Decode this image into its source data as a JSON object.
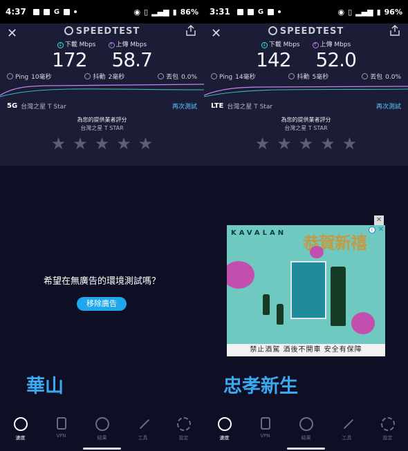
{
  "panels": [
    {
      "status": {
        "time": "4:37",
        "battery": "86%"
      },
      "brand": "SPEEDTEST",
      "download_label": "下載 Mbps",
      "upload_label": "上傳 Mbps",
      "download": "172",
      "upload": "58.7",
      "ping_label": "Ping",
      "ping": "10毫秒",
      "jitter_label": "抖動",
      "jitter": "2毫秒",
      "loss_label": "丟包",
      "loss": "0.0%",
      "network_type": "5G",
      "carrier": "台灣之星 T Star",
      "retest": "再次測試",
      "rate_title": "為您的提供業者評分",
      "rate_carrier": "台灣之星 T STAR",
      "location": "華山"
    },
    {
      "status": {
        "time": "3:31",
        "battery": "96%"
      },
      "brand": "SPEEDTEST",
      "download_label": "下載 Mbps",
      "upload_label": "上傳 Mbps",
      "download": "142",
      "upload": "52.0",
      "ping_label": "Ping",
      "ping": "14毫秒",
      "jitter_label": "抖動",
      "jitter": "5毫秒",
      "loss_label": "丟包",
      "loss": "0.0%",
      "network_type": "LTE",
      "carrier": "台灣之星 T Star",
      "retest": "再次測試",
      "rate_title": "為您的提供業者評分",
      "rate_carrier": "台灣之星 T STAR",
      "location": "忠孝新生"
    }
  ],
  "noads": {
    "question": "希望在無廣告的環境測試嗎？",
    "button": "移除廣告"
  },
  "ad": {
    "brand": "KAVALAN",
    "headline": "恭賀新禧",
    "footer": "禁止酒駕 酒後不開車 安全有保障"
  },
  "nav": [
    "速度",
    "VPN",
    "結果",
    "工具",
    "設定"
  ],
  "colors": {
    "accent": "#3aa9f0",
    "download": "#3fe3d3",
    "upload": "#c27ff0",
    "button": "#1fa7ee"
  }
}
